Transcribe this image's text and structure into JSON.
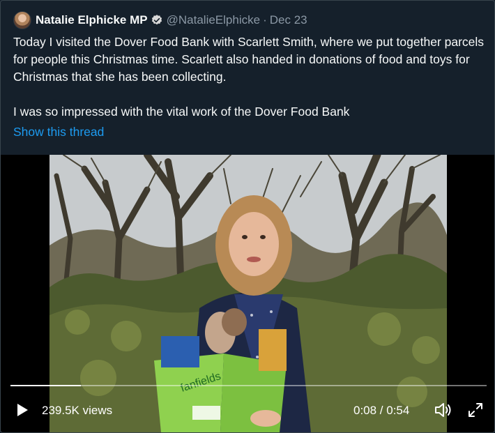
{
  "tweet": {
    "author_name": "Natalie Elphicke MP",
    "handle": "@NatalieElphicke",
    "separator": "·",
    "date": "Dec 23",
    "verified_icon": "verified-badge-icon",
    "paragraphs": [
      "Today I visited the Dover Food Bank with Scarlett Smith, where we put together parcels for people this Christmas time. Scarlett also handed in donations of food and toys for Christmas that she has been collecting.",
      "I was so impressed with the vital work of the Dover Food Bank"
    ],
    "thread_link": "Show this thread"
  },
  "video": {
    "views": "239.5K views",
    "time": "0:08 / 0:54",
    "progress_fraction": 0.148,
    "box_text": "fanfields",
    "icons": {
      "play": "play-icon",
      "volume": "volume-icon",
      "fullscreen": "fullscreen-icon"
    }
  },
  "colors": {
    "background": "#15202b",
    "link": "#1d9bf0",
    "muted": "#8b98a5",
    "verified": "#d9d9d9"
  }
}
